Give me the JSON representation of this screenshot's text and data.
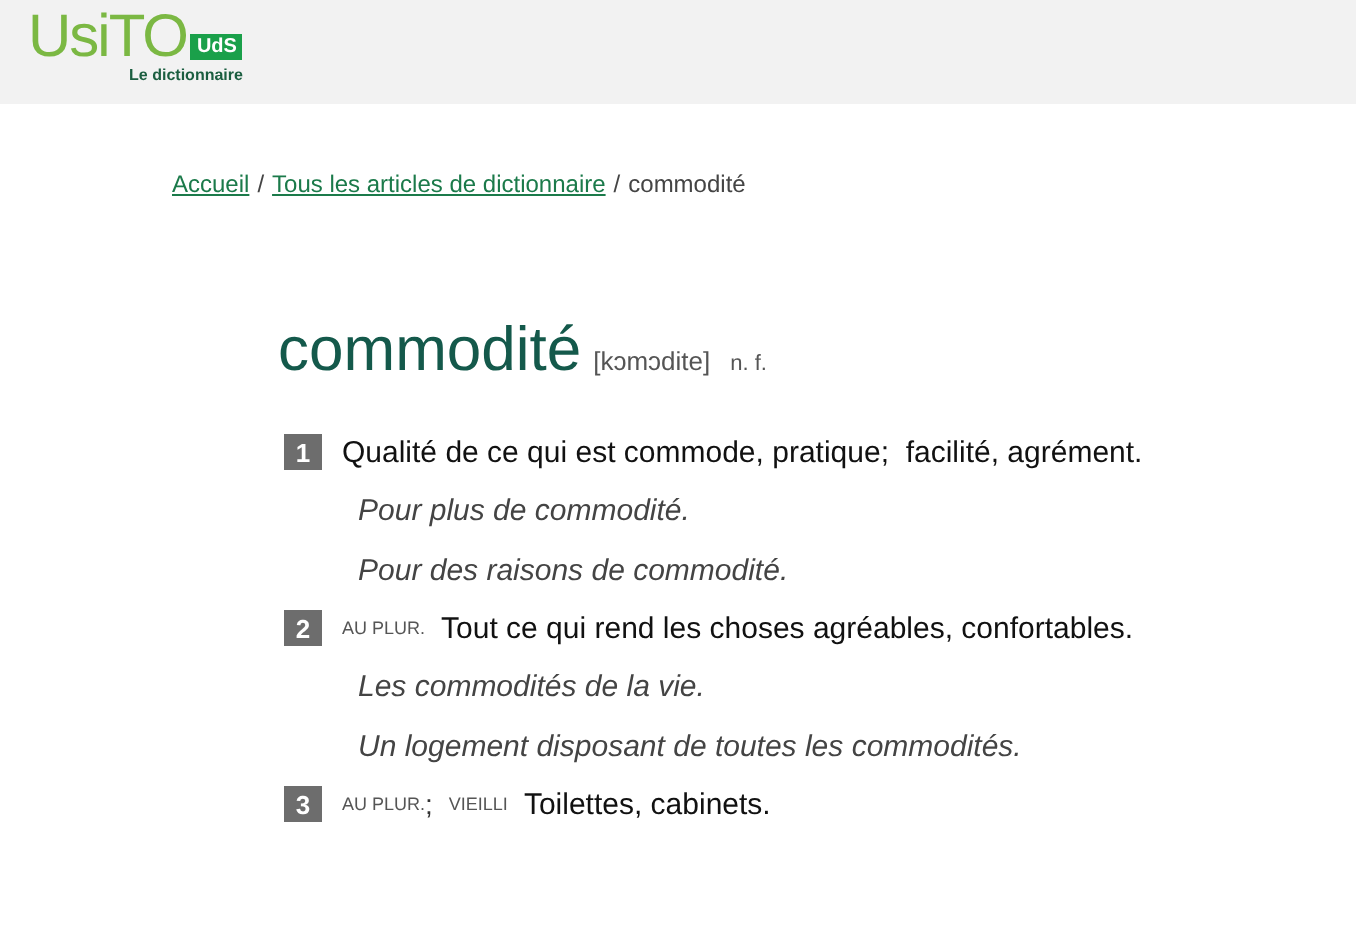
{
  "header": {
    "logo": "UsiTO",
    "badge": "UdS",
    "tagline": "Le dictionnaire"
  },
  "breadcrumb": [
    {
      "text": "Accueil",
      "kind": "link"
    },
    {
      "text": "/",
      "kind": "sep"
    },
    {
      "text": "Tous les articles de dictionnaire",
      "kind": "link"
    },
    {
      "text": "/",
      "kind": "sep"
    },
    {
      "text": "commodité",
      "kind": "current"
    }
  ],
  "entry": {
    "headword": "commodité",
    "pronunciation": "[kɔmɔdite]",
    "category": "n. f.",
    "senses": [
      {
        "number": "1",
        "definition": "Qualité de ce qui est commode, pratique;  facilité, agrément.",
        "examples": [
          "Pour plus de commodité.",
          "Pour des raisons de commodité."
        ]
      },
      {
        "number": "2",
        "usage": [
          {
            "kind": "label",
            "text": "AU PLUR."
          }
        ],
        "definition": "Tout ce qui rend les choses agréables, confortables.",
        "examples": [
          "Les commodités de la vie.",
          "Un logement disposant de toutes les commodités."
        ]
      },
      {
        "number": "3",
        "usage": [
          {
            "kind": "label",
            "text": "AU PLUR."
          },
          {
            "kind": "punct",
            "text": ";"
          },
          {
            "kind": "label",
            "text": "VIEILLI"
          }
        ],
        "definition": "Toilettes, cabinets."
      }
    ]
  }
}
